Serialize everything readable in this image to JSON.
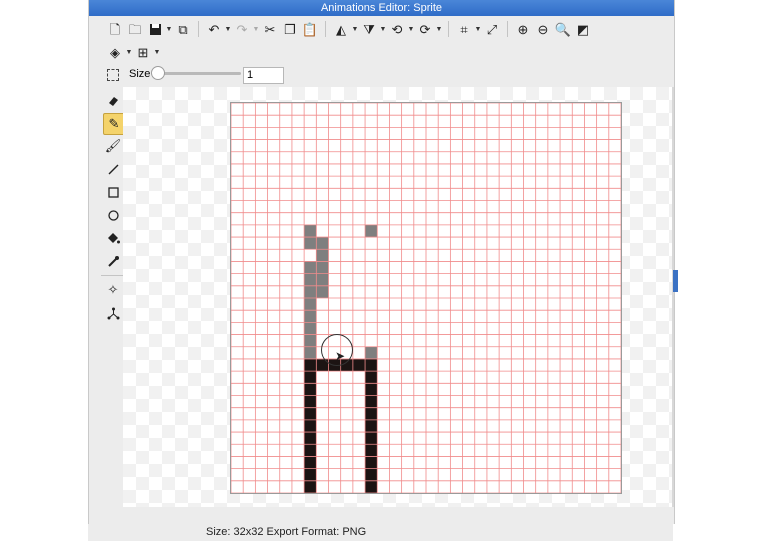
{
  "window": {
    "title": "Animations Editor: Sprite"
  },
  "toolbar_row1": {
    "icons": [
      "new-file-icon",
      "open-folder-icon",
      "save-icon",
      "export-icon",
      "undo-icon",
      "redo-icon",
      "cut-icon",
      "copy-icon",
      "paste-icon",
      "flip-horizontal-icon",
      "flip-vertical-icon",
      "rotate-left-icon",
      "rotate-right-icon",
      "crop-icon",
      "resize-icon",
      "zoom-in-icon",
      "zoom-out-icon",
      "zoom-fit-icon",
      "background-icon"
    ]
  },
  "toolbar_row2": {
    "icons": [
      "layers-icon",
      "grid-icon"
    ]
  },
  "size_control": {
    "label": "Size",
    "value": "1",
    "slider_level": 0.0
  },
  "tools": [
    {
      "name": "eraser-tool",
      "icon": "eraser-icon",
      "active": false
    },
    {
      "name": "pencil-tool",
      "icon": "pencil-icon",
      "active": true
    },
    {
      "name": "brush-tool",
      "icon": "brush-icon",
      "active": false
    },
    {
      "name": "line-tool",
      "icon": "line-icon",
      "active": false
    },
    {
      "name": "rectangle-tool",
      "icon": "rectangle-icon",
      "active": false
    },
    {
      "name": "ellipse-tool",
      "icon": "ellipse-icon",
      "active": false
    },
    {
      "name": "fill-tool",
      "icon": "paint-bucket-icon",
      "active": false
    },
    {
      "name": "eyedropper-tool",
      "icon": "eyedropper-icon",
      "active": false
    },
    {
      "name": "select-point-tool",
      "icon": "crosshair-icon",
      "active": false
    },
    {
      "name": "origin-tool",
      "icon": "origin-icon",
      "active": false
    }
  ],
  "canvas": {
    "grid_size": 32,
    "grid_color": "#f08b8b",
    "pixel_colors": {
      "gray": "#7f7f7f",
      "black": "#1c1413"
    },
    "gray_cells": [
      [
        6,
        10
      ],
      [
        6,
        11
      ],
      [
        7,
        11
      ],
      [
        7,
        12
      ],
      [
        6,
        13
      ],
      [
        7,
        13
      ],
      [
        6,
        14
      ],
      [
        7,
        14
      ],
      [
        6,
        15
      ],
      [
        7,
        15
      ],
      [
        6,
        16
      ],
      [
        6,
        17
      ],
      [
        6,
        18
      ],
      [
        6,
        19
      ],
      [
        6,
        20
      ],
      [
        11,
        10
      ],
      [
        11,
        20
      ]
    ],
    "black_cells": [
      [
        6,
        21
      ],
      [
        7,
        21
      ],
      [
        8,
        21
      ],
      [
        9,
        21
      ],
      [
        10,
        21
      ],
      [
        11,
        21
      ],
      [
        6,
        22
      ],
      [
        11,
        22
      ],
      [
        6,
        23
      ],
      [
        11,
        23
      ],
      [
        6,
        24
      ],
      [
        11,
        24
      ],
      [
        6,
        25
      ],
      [
        11,
        25
      ],
      [
        6,
        26
      ],
      [
        11,
        26
      ],
      [
        6,
        27
      ],
      [
        11,
        27
      ],
      [
        6,
        28
      ],
      [
        11,
        28
      ],
      [
        6,
        29
      ],
      [
        11,
        29
      ],
      [
        6,
        30
      ],
      [
        11,
        30
      ],
      [
        6,
        31
      ],
      [
        11,
        31
      ]
    ]
  },
  "status": {
    "text": "Size: 32x32   Export Format: PNG"
  }
}
